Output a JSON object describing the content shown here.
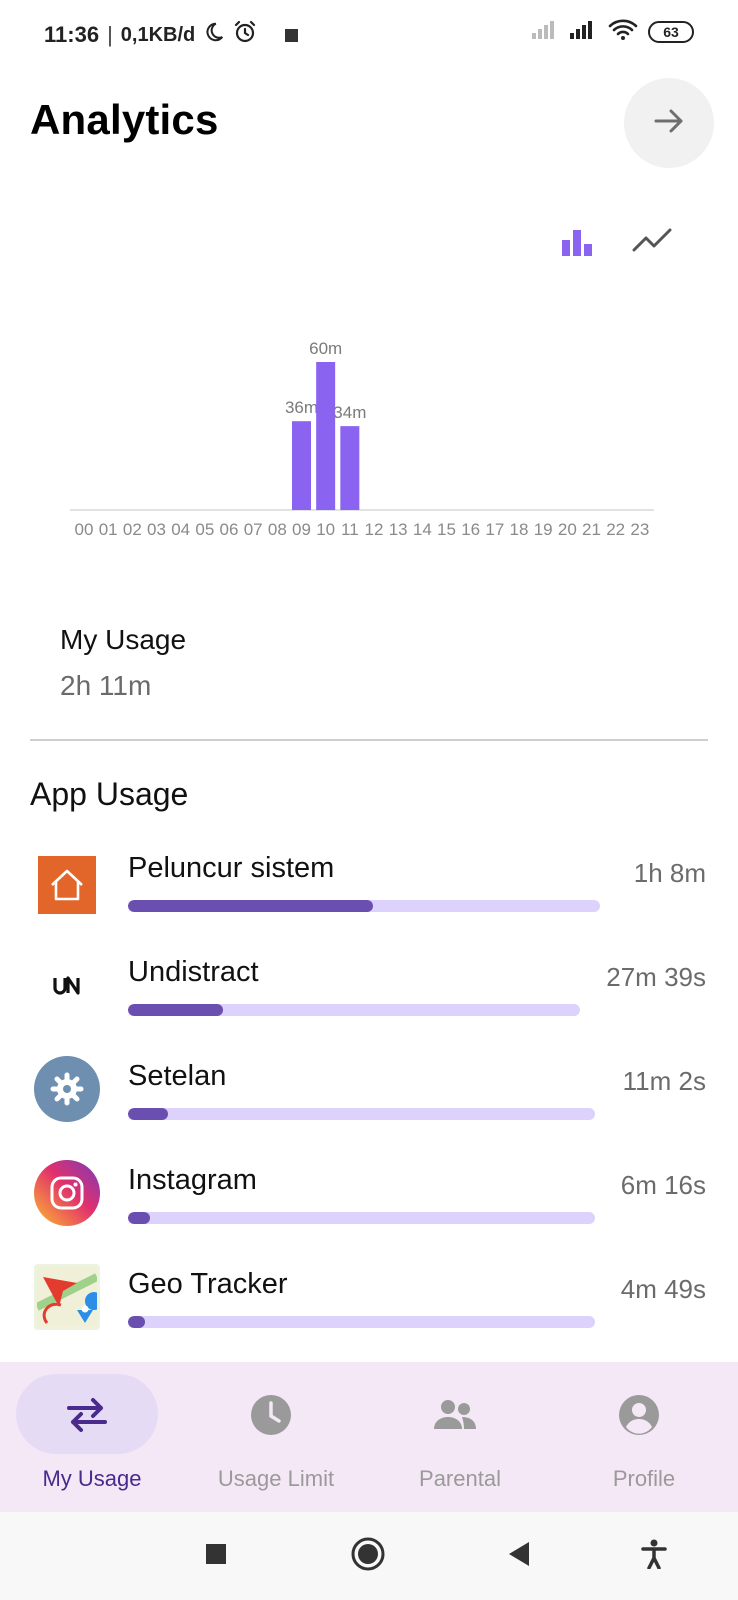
{
  "status_bar": {
    "time": "11:36",
    "speed": "0,1KB/d",
    "battery": "63"
  },
  "header": {
    "title": "Analytics"
  },
  "chart_data": {
    "type": "bar",
    "categories": [
      "00",
      "01",
      "02",
      "03",
      "04",
      "05",
      "06",
      "07",
      "08",
      "09",
      "10",
      "11",
      "12",
      "13",
      "14",
      "15",
      "16",
      "17",
      "18",
      "19",
      "20",
      "21",
      "22",
      "23"
    ],
    "values": [
      0,
      0,
      0,
      0,
      0,
      0,
      0,
      0,
      0,
      36,
      60,
      34,
      0,
      0,
      0,
      0,
      0,
      0,
      0,
      0,
      0,
      0,
      0,
      0
    ],
    "value_labels": [
      "",
      "",
      "",
      "",
      "",
      "",
      "",
      "",
      "",
      "36m",
      "60m",
      "34m",
      "",
      "",
      "",
      "",
      "",
      "",
      "",
      "",
      "",
      "",
      "",
      ""
    ],
    "ylim": [
      0,
      60
    ],
    "bar_color": "#8a64f0",
    "axis_color": "#e2e2e2"
  },
  "summary": {
    "label": "My Usage",
    "value": "2h 11m"
  },
  "app_usage": {
    "title": "App Usage",
    "apps": [
      {
        "name": "Peluncur sistem",
        "time": "1h 8m",
        "fraction": 0.52,
        "icon": "home-icon"
      },
      {
        "name": "Undistract",
        "time": "27m 39s",
        "fraction": 0.21,
        "icon": "undistract-logo-icon"
      },
      {
        "name": "Setelan",
        "time": "11m 2s",
        "fraction": 0.085,
        "icon": "settings-gear-icon"
      },
      {
        "name": "Instagram",
        "time": "6m 16s",
        "fraction": 0.048,
        "icon": "instagram-icon"
      },
      {
        "name": "Geo Tracker",
        "time": "4m 49s",
        "fraction": 0.037,
        "icon": "geo-tracker-icon"
      }
    ]
  },
  "bottom_nav": {
    "items": [
      {
        "label": "My Usage",
        "icon": "swap-arrows-icon",
        "active": true
      },
      {
        "label": "Usage Limit",
        "icon": "clock-icon",
        "active": false
      },
      {
        "label": "Parental",
        "icon": "people-icon",
        "active": false
      },
      {
        "label": "Profile",
        "icon": "account-circle-icon",
        "active": false
      }
    ]
  },
  "colors": {
    "accent": "#8a64f0",
    "bar_fill": "#6b4fb0",
    "bar_track": "#ddd2fb",
    "nav_background": "#f5e8f6",
    "nav_active": "#4a2a8c"
  }
}
